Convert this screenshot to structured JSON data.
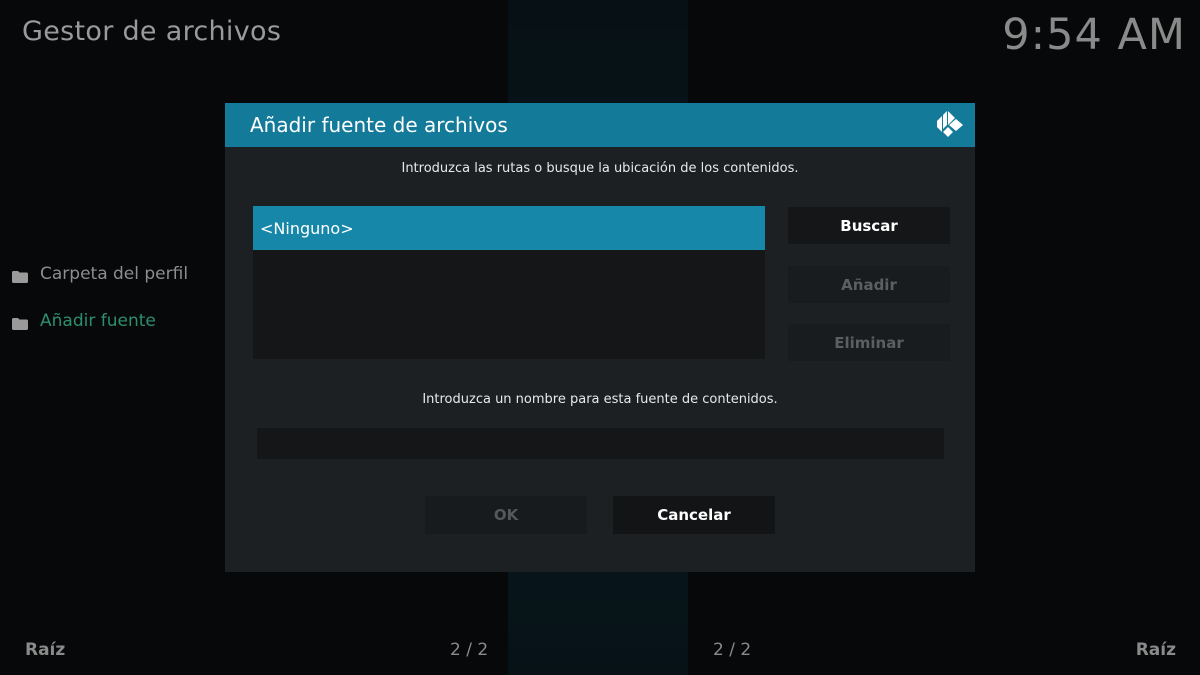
{
  "header": {
    "title": "Gestor de archivos",
    "clock": "9:54 AM"
  },
  "sidebar": {
    "items": [
      {
        "label": "Carpeta del perfil",
        "icon": "folder-icon",
        "active": false
      },
      {
        "label": "Añadir fuente",
        "icon": "folder-icon",
        "active": true
      }
    ]
  },
  "footer": {
    "left_label": "Raíz",
    "left_count": "2 / 2",
    "right_count": "2 / 2",
    "right_label": "Raíz"
  },
  "dialog": {
    "title": "Añadir fuente de archivos",
    "logo_icon": "kodi-logo-icon",
    "paths_prompt": "Introduzca las rutas o busque la ubicación de los contenidos.",
    "paths": [
      "<Ninguno>"
    ],
    "buttons": {
      "browse": "Buscar",
      "add": "Añadir",
      "remove": "Eliminar"
    },
    "name_prompt": "Introduzca un nombre para esta fuente de contenidos.",
    "name_value": "",
    "ok": "OK",
    "cancel": "Cancelar"
  },
  "colors": {
    "accent": "#147a99",
    "selection": "#1687a8",
    "active_text": "#2e8f6c"
  }
}
